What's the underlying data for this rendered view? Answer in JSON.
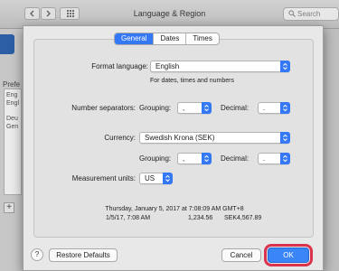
{
  "window": {
    "title": "Language & Region",
    "search_placeholder": "Search"
  },
  "background": {
    "preferred_label": "Prefe",
    "list_items": [
      "Eng",
      "Engl",
      "Deu",
      "Gen"
    ]
  },
  "tabs": [
    {
      "label": "General",
      "active": true
    },
    {
      "label": "Dates",
      "active": false
    },
    {
      "label": "Times",
      "active": false
    }
  ],
  "format_language": {
    "label": "Format language:",
    "value": "English",
    "hint": "For dates, times and numbers"
  },
  "number_separators": {
    "label": "Number separators:",
    "grouping_label": "Grouping:",
    "grouping_value": ",",
    "decimal_label": "Decimal:",
    "decimal_value": "."
  },
  "currency": {
    "label": "Currency:",
    "value": "Swedish Krona (SEK)",
    "grouping_label": "Grouping:",
    "grouping_value": ",",
    "decimal_label": "Decimal:",
    "decimal_value": "."
  },
  "measurement": {
    "label": "Measurement units:",
    "value": "US"
  },
  "preview": {
    "line1": "Thursday, January 5, 2017 at 7:08:09 AM GMT+8",
    "short_date": "1/5/17, 7:08 AM",
    "number": "1,234.56",
    "currency": "SEK4,567.89"
  },
  "buttons": {
    "help": "?",
    "restore_defaults": "Restore Defaults",
    "cancel": "Cancel",
    "ok": "OK"
  },
  "colors": {
    "accent": "#3478f6",
    "highlight": "#d9334d"
  }
}
